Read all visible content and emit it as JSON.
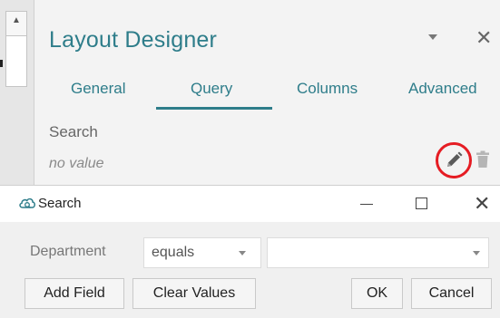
{
  "panel": {
    "title": "Layout Designer",
    "tabs": [
      {
        "label": "General"
      },
      {
        "label": "Query"
      },
      {
        "label": "Columns"
      },
      {
        "label": "Advanced"
      }
    ],
    "active_tab": "Query",
    "section_label": "Search",
    "search_value": "no value",
    "accent_color": "#2e7d8a",
    "highlight_color": "#e51c23",
    "icons": [
      "chevron-down-icon",
      "close-icon",
      "pencil-icon",
      "trash-icon"
    ]
  },
  "dialog": {
    "title": "Search",
    "field_label": "Department",
    "operator": "equals",
    "value": "",
    "buttons": {
      "add_field": "Add Field",
      "clear_values": "Clear Values",
      "ok": "OK",
      "cancel": "Cancel"
    },
    "icons": [
      "cloud-search-icon",
      "minimize-icon",
      "maximize-icon",
      "close-icon"
    ]
  }
}
